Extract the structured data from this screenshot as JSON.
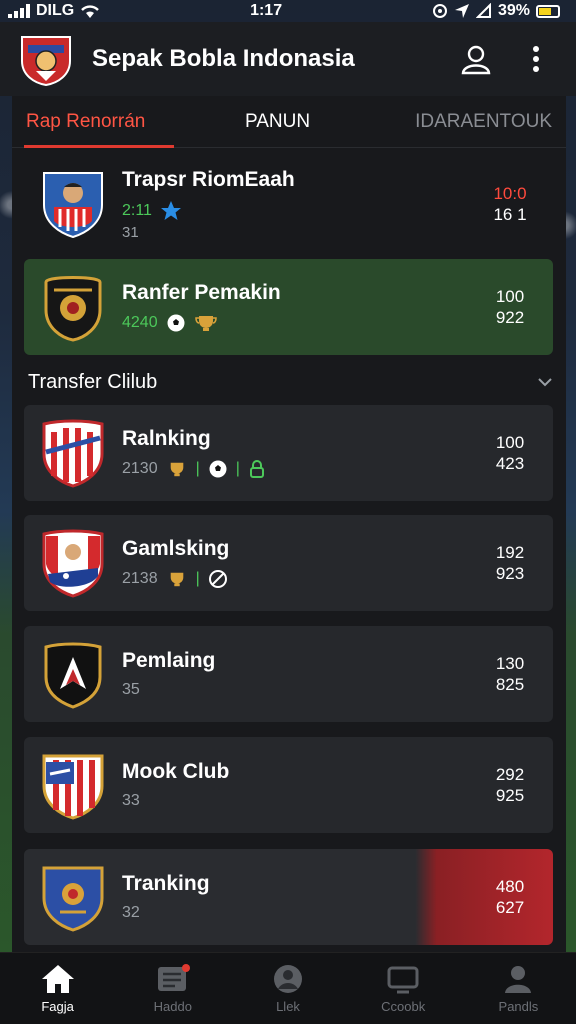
{
  "status_bar": {
    "left": "DILG",
    "time": "1:17",
    "battery": "39%"
  },
  "app": {
    "title": "Sepak Bobla Indonasia"
  },
  "tabs": [
    {
      "label": "Rap Renorrán"
    },
    {
      "label": "PANUN"
    },
    {
      "label": "IDARAENTOUK"
    }
  ],
  "cards": [
    {
      "name": "Trapsr RiomEaah",
      "meta": "2:11",
      "sub": "31",
      "stat_top": "10:0",
      "stat_bottom": "16 1"
    },
    {
      "name": "Ranfer Pemakin",
      "meta": "4240",
      "stat_top": "100",
      "stat_bottom": "922"
    },
    {
      "name": "Ralnking",
      "meta": "2130",
      "stat_top": "100",
      "stat_bottom": "423"
    },
    {
      "name": "Gamlsking",
      "meta": "2138",
      "stat_top": "192",
      "stat_bottom": "923"
    },
    {
      "name": "Pemlaing",
      "meta": "35",
      "stat_top": "130",
      "stat_bottom": "825"
    },
    {
      "name": "Mook Club",
      "meta": "33",
      "stat_top": "292",
      "stat_bottom": "925"
    },
    {
      "name": "Tranking",
      "meta": "32",
      "stat_top": "480",
      "stat_bottom": "627"
    }
  ],
  "section": {
    "title": "Transfer Clilub"
  },
  "bottom_nav": [
    {
      "label": "Fagja",
      "icon": "home-icon",
      "active": true
    },
    {
      "label": "Haddo",
      "icon": "news-icon",
      "active": false
    },
    {
      "label": "Llek",
      "icon": "ball-icon",
      "active": false
    },
    {
      "label": "Ccoobk",
      "icon": "tv-icon",
      "active": false
    },
    {
      "label": "Pandls",
      "icon": "profile-icon",
      "active": false
    }
  ],
  "colors": {
    "accent": "#e03a30",
    "highlight_green": "#2a4a2b",
    "highlight_red": "#b3262c"
  }
}
